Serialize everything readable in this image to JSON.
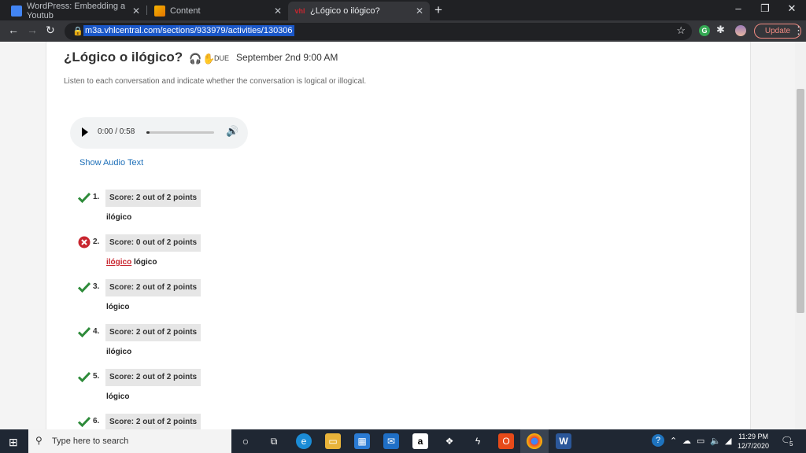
{
  "browser": {
    "tabs": [
      {
        "title": "WordPress: Embedding a Youtub",
        "favicon": "docs-icon",
        "active": false
      },
      {
        "title": "Content",
        "favicon": "wordpress-icon",
        "active": false
      },
      {
        "title": "¿Lógico o ilógico?",
        "favicon": "vhl-icon",
        "active": true
      }
    ],
    "url": "m3a.vhlcentral.com/sections/933979/activities/130306",
    "update_label": "Update"
  },
  "activity": {
    "title": "¿Lógico o ilógico?",
    "due_label": "DUE",
    "due_date": "September 2nd 9:00 AM",
    "instructions": "Listen to each conversation and indicate whether the conversation is logical or illogical.",
    "audio": {
      "time": "0:00 / 0:58",
      "progress": 0.05
    },
    "show_audio_text": "Show Audio Text",
    "questions": [
      {
        "number": "1.",
        "status": "correct",
        "score": "Score: 2 out of 2 points",
        "answer": "ilógico",
        "incorrect_answer": ""
      },
      {
        "number": "2.",
        "status": "incorrect",
        "score": "Score: 0 out of 2 points",
        "answer": "lógico",
        "incorrect_answer": "ilógico"
      },
      {
        "number": "3.",
        "status": "correct",
        "score": "Score: 2 out of 2 points",
        "answer": "lógico",
        "incorrect_answer": ""
      },
      {
        "number": "4.",
        "status": "correct",
        "score": "Score: 2 out of 2 points",
        "answer": "ilógico",
        "incorrect_answer": ""
      },
      {
        "number": "5.",
        "status": "correct",
        "score": "Score: 2 out of 2 points",
        "answer": "lógico",
        "incorrect_answer": ""
      },
      {
        "number": "6.",
        "status": "correct",
        "score": "Score: 2 out of 2 points",
        "answer": "",
        "incorrect_answer": ""
      }
    ]
  },
  "taskbar": {
    "search_placeholder": "Type here to search",
    "time": "11:29 PM",
    "date": "12/7/2020",
    "notification_count": "5"
  },
  "colors": {
    "correct": "#2e8b3a",
    "incorrect": "#c8262f",
    "link": "#1d6fb8",
    "score_bg": "#e6e6e6"
  }
}
